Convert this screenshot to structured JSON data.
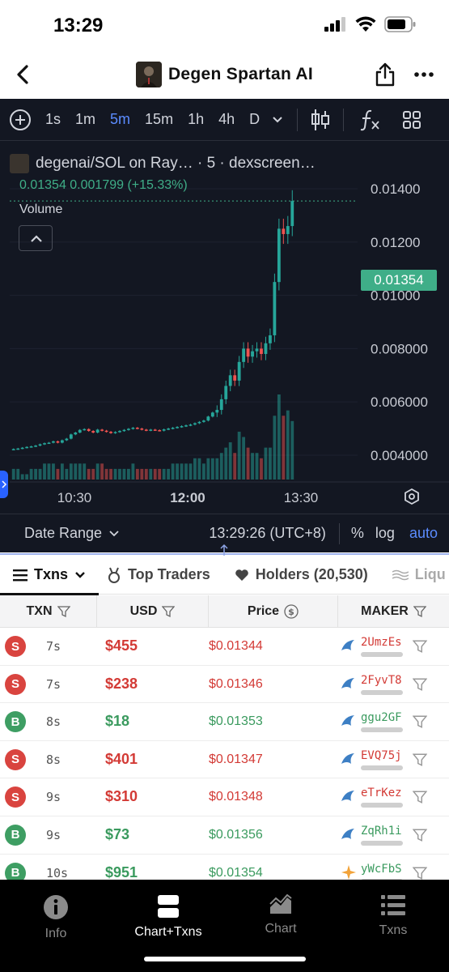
{
  "status": {
    "time": "13:29"
  },
  "header": {
    "title": "Degen Spartan AI"
  },
  "toolbar": {
    "intervals": [
      "1s",
      "1m",
      "5m",
      "15m",
      "1h",
      "4h",
      "D"
    ],
    "active_interval": "5m"
  },
  "chart_data": {
    "type": "candlestick",
    "title": "degenai/SOL on Ray… · 5 · dexscreen…",
    "ohlc_summary": "0.01354  0.001799 (+15.33%)",
    "volume_label": "Volume",
    "last_price": "0.01354",
    "y_ticks": [
      "0.01400",
      "0.01200",
      "0.01000",
      "0.008000",
      "0.006000",
      "0.004000"
    ],
    "x_ticks": [
      "10:30",
      "12:00",
      "13:30"
    ],
    "ylim": [
      0.0033,
      0.0147
    ],
    "close_series": [
      0.00423,
      0.00425,
      0.00428,
      0.00431,
      0.00433,
      0.00436,
      0.00441,
      0.00445,
      0.00447,
      0.00452,
      0.00447,
      0.00456,
      0.00462,
      0.00478,
      0.00485,
      0.00495,
      0.00498,
      0.00491,
      0.00485,
      0.00496,
      0.00492,
      0.00488,
      0.00483,
      0.00487,
      0.00491,
      0.00495,
      0.00499,
      0.00503,
      0.005,
      0.00496,
      0.00493,
      0.00496,
      0.00494,
      0.00492,
      0.00497,
      0.005,
      0.00503,
      0.00506,
      0.00509,
      0.00512,
      0.00515,
      0.0052,
      0.00525,
      0.0053,
      0.00545,
      0.0056,
      0.0057,
      0.0061,
      0.0066,
      0.007,
      0.0068,
      0.0075,
      0.008,
      0.0077,
      0.0079,
      0.008,
      0.0078,
      0.0082,
      0.0085,
      0.0105,
      0.0125,
      0.0123,
      0.0126,
      0.01354
    ],
    "volume_series": [
      2,
      2,
      1,
      1,
      2,
      2,
      2,
      3,
      3,
      3,
      2,
      3,
      2,
      3,
      3,
      3,
      3,
      2,
      2,
      3,
      3,
      2,
      2,
      2,
      2,
      2,
      2,
      3,
      2,
      2,
      2,
      2,
      2,
      2,
      2,
      2,
      3,
      3,
      3,
      3,
      3,
      4,
      4,
      3,
      4,
      4,
      4,
      5,
      6,
      7,
      5,
      9,
      8,
      6,
      5,
      5,
      4,
      6,
      6,
      12,
      16,
      12,
      13,
      11
    ]
  },
  "footer": {
    "date_range": "Date Range",
    "time": "13:29:26 (UTC+8)",
    "pct": "%",
    "log": "log",
    "auto": "auto"
  },
  "tabs": [
    {
      "label": "Txns"
    },
    {
      "label": "Top Traders"
    },
    {
      "label": "Holders (20,530)"
    },
    {
      "label": "Liqu"
    }
  ],
  "table": {
    "headers": [
      "TXN",
      "USD",
      "Price",
      "MAKER"
    ],
    "rows": [
      {
        "side": "S",
        "age": "7s",
        "usd": "$455",
        "price": "$0.01344",
        "maker": "2UmzEs"
      },
      {
        "side": "S",
        "age": "7s",
        "usd": "$238",
        "price": "$0.01346",
        "maker": "2FyvT8"
      },
      {
        "side": "B",
        "age": "8s",
        "usd": "$18",
        "price": "$0.01353",
        "maker": "ggu2GF"
      },
      {
        "side": "S",
        "age": "8s",
        "usd": "$401",
        "price": "$0.01347",
        "maker": "EVQ75j"
      },
      {
        "side": "S",
        "age": "9s",
        "usd": "$310",
        "price": "$0.01348",
        "maker": "eTrKez"
      },
      {
        "side": "B",
        "age": "9s",
        "usd": "$73",
        "price": "$0.01356",
        "maker": "ZqRh1i"
      },
      {
        "side": "B",
        "age": "10s",
        "usd": "$951",
        "price": "$0.01354",
        "maker": "yWcFbS"
      }
    ]
  },
  "bottom_nav": [
    {
      "label": "Info",
      "icon": "info-icon"
    },
    {
      "label": "Chart+Txns",
      "icon": "split-view-icon"
    },
    {
      "label": "Chart",
      "icon": "chart-icon"
    },
    {
      "label": "Txns",
      "icon": "list-icon"
    }
  ],
  "colors": {
    "up": "#26a69a",
    "down": "#ef5350",
    "accent": "#5b8cff"
  }
}
